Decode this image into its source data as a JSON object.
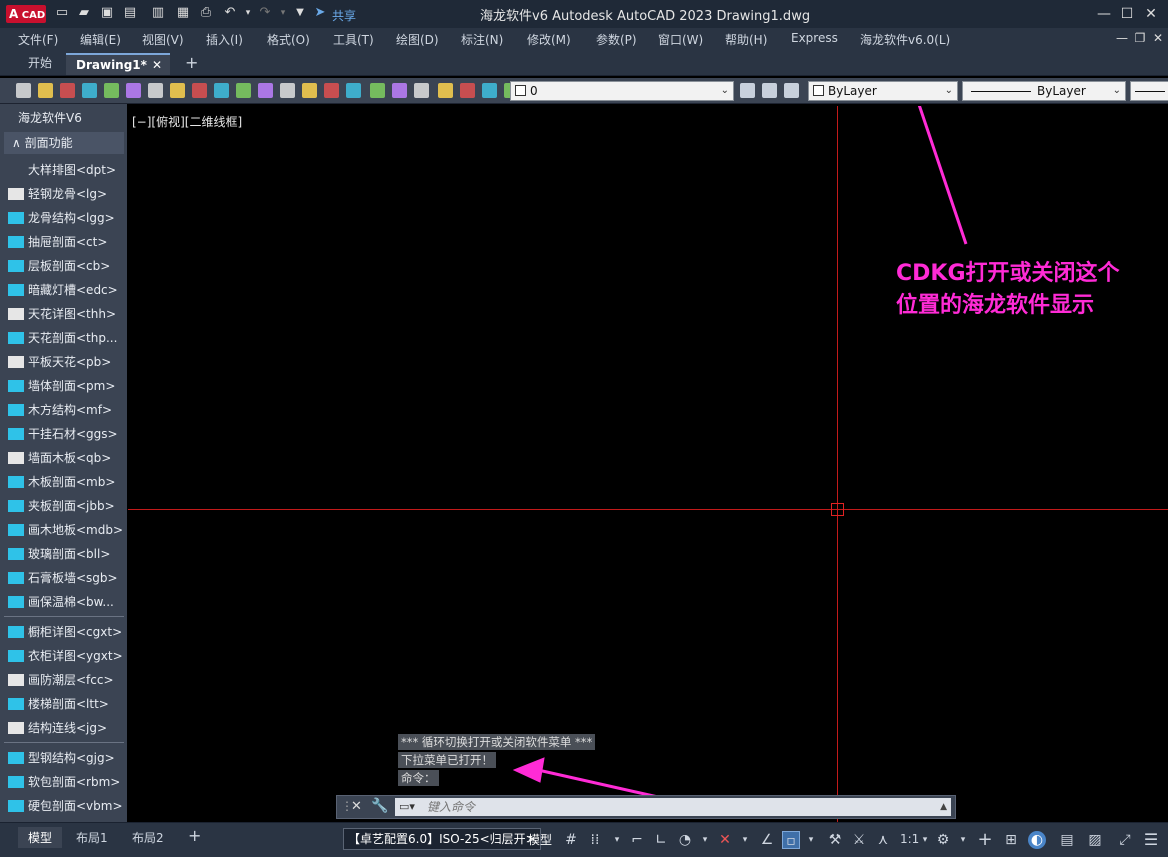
{
  "app": {
    "logo_text": "A",
    "logo_sub": "CAD",
    "share_label": "共享",
    "window_title": "海龙软件v6 Autodesk AutoCAD 2023    Drawing1.dwg"
  },
  "menu": [
    "文件(F)",
    "编辑(E)",
    "视图(V)",
    "插入(I)",
    "格式(O)",
    "工具(T)",
    "绘图(D)",
    "标注(N)",
    "修改(M)",
    "参数(P)",
    "窗口(W)",
    "帮助(H)",
    "Express",
    "海龙软件v6.0(L)"
  ],
  "tabs": {
    "start": "开始",
    "drawing": "Drawing1*",
    "add": "+"
  },
  "toolbar": {
    "layer_value": "0",
    "color_value": "ByLayer",
    "linetype_value": "ByLayer"
  },
  "palette": {
    "title": "海龙软件V6",
    "section": "剖面功能",
    "items": [
      "大样排图<dpt>",
      "轻钢龙骨<lg>",
      "龙骨结构<lgg>",
      "抽屉剖面<ct>",
      "层板剖面<cb>",
      "暗藏灯槽<edc>",
      "天花详图<thh>",
      "天花剖面<thp...",
      "平板天花<pb>",
      "墙体剖面<pm>",
      "木方结构<mf>",
      "干挂石材<ggs>",
      "墙面木板<qb>",
      "木板剖面<mb>",
      "夹板剖面<jbb>",
      "画木地板<mdb>",
      "玻璃剖面<bll>",
      "石膏板墙<sgb>",
      "画保温棉<bw..."
    ],
    "items2": [
      "橱柜详图<cgxt>",
      "衣柜详图<ygxt>",
      "画防潮层<fcc>",
      "楼梯剖面<ltt>",
      "结构连线<jg>"
    ],
    "items3": [
      "型钢结构<gjg>",
      "软包剖面<rbm>",
      "硬包剖面<vbm>"
    ]
  },
  "viewport": {
    "label": "[−][俯视][二维线框]"
  },
  "command_history": [
    "***  循环切换打开或关闭软件菜单  ***",
    "下拉菜单已打开！",
    "命令："
  ],
  "command_placeholder": "键入命令",
  "annotation": {
    "line1": "CDKG打开或关闭这个",
    "line2": "位置的海龙软件显示",
    "color": "#ff2bd6"
  },
  "status": {
    "model_tab": "模型",
    "layout1": "布局1",
    "layout2": "布局2",
    "add": "+",
    "config_badge": "【卓艺配置6.0】ISO-25<归层开>",
    "model_label": "模型",
    "scale": "1:1"
  }
}
